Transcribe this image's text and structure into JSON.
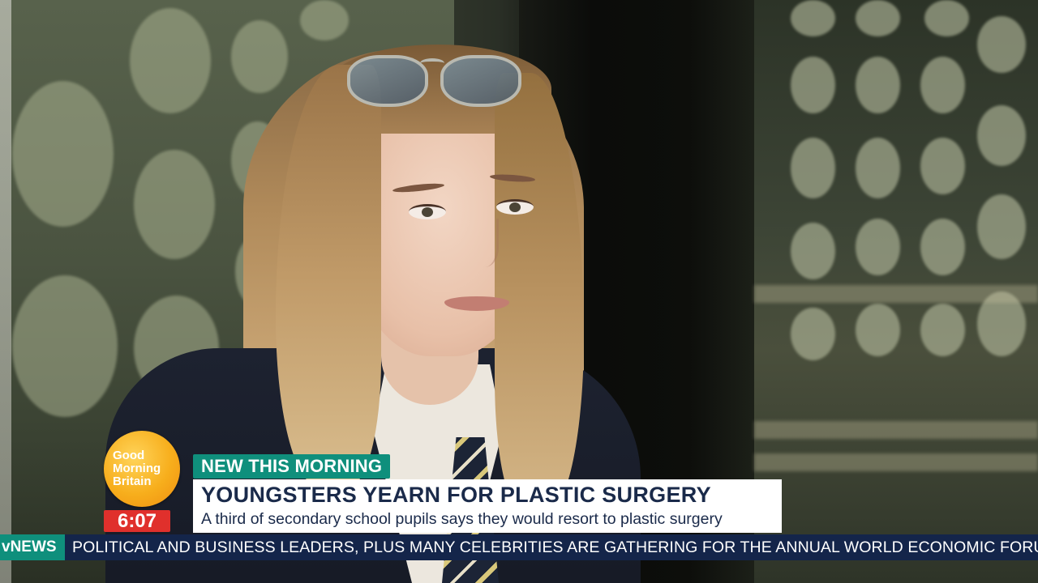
{
  "scene": {
    "background_icon": "studio-bokeh-background",
    "subject_icon": "interviewee-portrait"
  },
  "logo": {
    "lines": [
      "Good",
      "Morning",
      "Britain"
    ],
    "color": "#f7ae1c"
  },
  "clock": {
    "time": "6:07",
    "color": "#e0302c"
  },
  "strap": {
    "tag": "NEW THIS MORNING",
    "tag_color": "#0f8f7c",
    "headline": "YOUNGSTERS YEARN FOR PLASTIC SURGERY",
    "subheadline": "A third of secondary school pupils says they would resort to plastic surgery",
    "text_color": "#1a2a4a"
  },
  "ticker": {
    "brand": "vNEWS",
    "text": "POLITICAL AND BUSINESS LEADERS, PLUS MANY CELEBRITIES ARE GATHERING FOR THE ANNUAL  WORLD ECONOMIC FORUM IN D",
    "background": "#14254a"
  }
}
